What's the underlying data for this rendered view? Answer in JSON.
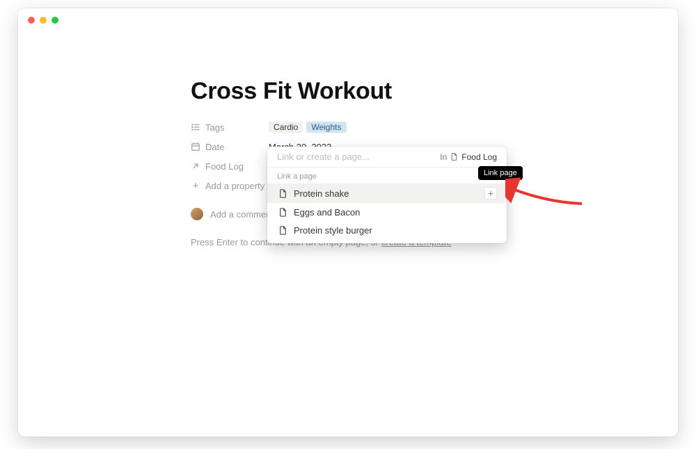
{
  "page": {
    "title": "Cross Fit Workout"
  },
  "properties": {
    "tags": {
      "label": "Tags",
      "values": [
        "Cardio",
        "Weights"
      ]
    },
    "date": {
      "label": "Date",
      "value": "March 20, 2023"
    },
    "foodLog": {
      "label": "Food Log"
    },
    "addProperty": "Add a property"
  },
  "comment": {
    "placeholder": "Add a comment..."
  },
  "emptyPage": {
    "prefix": "Press Enter to continue with an empty page, or ",
    "link": "create a template"
  },
  "popup": {
    "searchPlaceholder": "Link or create a page...",
    "contextPrefix": "In",
    "contextDb": "Food Log",
    "sectionLabel": "Link a page",
    "options": [
      {
        "label": "Protein shake",
        "selected": true
      },
      {
        "label": "Eggs and Bacon",
        "selected": false
      },
      {
        "label": "Protein style burger",
        "selected": false
      }
    ]
  },
  "tooltip": "Link page"
}
